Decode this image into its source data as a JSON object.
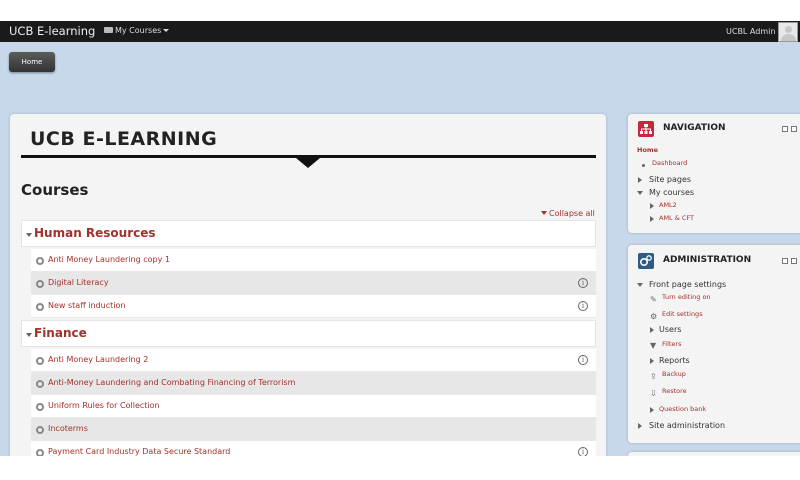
{
  "navbar": {
    "brand": "UCB E-learning",
    "my_courses": "My Courses",
    "username": "UCBL Admin"
  },
  "breadcrumb": {
    "home": "Home"
  },
  "site_title": "UCB E-LEARNING",
  "courses": {
    "heading": "Courses",
    "collapse_all": "Collapse all",
    "categories": [
      {
        "name": "Human Resources",
        "courses": [
          {
            "name": "Anti Money Laundering copy 1",
            "info": false
          },
          {
            "name": "Digital Literacy",
            "info": true
          },
          {
            "name": "New staff induction",
            "info": true
          }
        ]
      },
      {
        "name": "Finance",
        "courses": [
          {
            "name": "Anti Money Laundering 2",
            "info": true
          },
          {
            "name": "Anti-Money Laundering and Combating Financing of Terrorism",
            "info": false
          },
          {
            "name": "Uniform Rules for Collection",
            "info": false
          },
          {
            "name": "Incoterms",
            "info": false
          },
          {
            "name": "Payment Card Industry Data Secure Standard",
            "info": true
          }
        ]
      }
    ]
  },
  "navigation_block": {
    "title": "NAVIGATION",
    "home": "Home",
    "dashboard": "Dashboard",
    "site_pages": "Site pages",
    "my_courses": "My courses",
    "course_1": "AML2",
    "course_2": "AML & CFT"
  },
  "admin_block": {
    "title": "ADMINISTRATION",
    "front_page_settings": "Front page settings",
    "turn_editing_on": "Turn editing on",
    "edit_settings": "Edit settings",
    "users": "Users",
    "filters": "Filters",
    "reports": "Reports",
    "backup": "Backup",
    "restore": "Restore",
    "question_bank": "Question bank",
    "site_administration": "Site administration"
  },
  "colors": {
    "link": "#a3312b",
    "navbar": "#1a1a1a",
    "page_bg": "#c6d8ea",
    "nav_icon": "#c8283a",
    "admin_icon": "#2d5a86"
  }
}
